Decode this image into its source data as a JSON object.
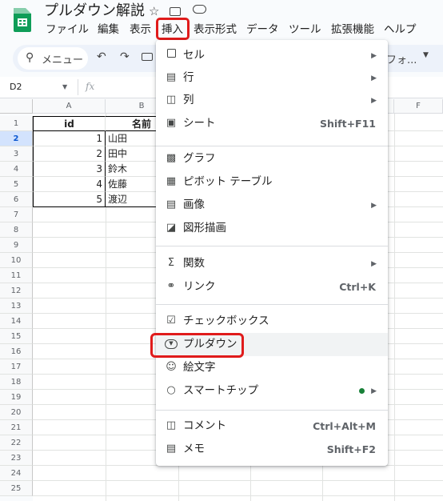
{
  "app": {
    "document_title": "プルダウン解説"
  },
  "menubar": [
    "ファイル",
    "編集",
    "表示",
    "挿入",
    "表示形式",
    "データ",
    "ツール",
    "拡張機能",
    "ヘルプ"
  ],
  "toolbar": {
    "search_label": "メニュー",
    "font_label": "フォ..."
  },
  "name_box": "D2",
  "fx_label": "fx",
  "columns": [
    "A",
    "B",
    "F"
  ],
  "rows": [
    "1",
    "2",
    "3",
    "4",
    "5",
    "6",
    "7",
    "8",
    "9",
    "10",
    "11",
    "12",
    "13",
    "14",
    "15",
    "16",
    "17",
    "18",
    "19",
    "20",
    "21",
    "22",
    "23",
    "24",
    "25"
  ],
  "table": {
    "headers": [
      "id",
      "名前"
    ],
    "records": [
      [
        "1",
        "山田"
      ],
      [
        "2",
        "田中"
      ],
      [
        "3",
        "鈴木"
      ],
      [
        "4",
        "佐藤"
      ],
      [
        "5",
        "渡辺"
      ]
    ]
  },
  "insert_menu": {
    "items": [
      {
        "label": "セル",
        "icon": "square-icon",
        "shortcut": "",
        "submenu": true
      },
      {
        "label": "行",
        "icon": "rows-icon",
        "shortcut": "",
        "submenu": true
      },
      {
        "label": "列",
        "icon": "columns-icon",
        "shortcut": "",
        "submenu": true
      },
      {
        "label": "シート",
        "icon": "sheet-icon",
        "shortcut": "Shift+F11",
        "submenu": false
      },
      {
        "label": "グラフ",
        "icon": "chart-icon",
        "shortcut": "",
        "submenu": false
      },
      {
        "label": "ピボット テーブル",
        "icon": "pivot-icon",
        "shortcut": "",
        "submenu": false
      },
      {
        "label": "画像",
        "icon": "image-icon",
        "shortcut": "",
        "submenu": true
      },
      {
        "label": "図形描画",
        "icon": "drawing-icon",
        "shortcut": "",
        "submenu": false
      },
      {
        "label": "関数",
        "icon": "sigma-icon",
        "shortcut": "",
        "submenu": true
      },
      {
        "label": "リンク",
        "icon": "link-icon",
        "shortcut": "Ctrl+K",
        "submenu": false
      },
      {
        "label": "チェックボックス",
        "icon": "checkbox-icon",
        "shortcut": "",
        "submenu": false
      },
      {
        "label": "プルダウン",
        "icon": "dropdown-icon",
        "shortcut": "",
        "submenu": false
      },
      {
        "label": "絵文字",
        "icon": "emoji-icon",
        "shortcut": "",
        "submenu": false
      },
      {
        "label": "スマートチップ",
        "icon": "smart-chip-icon",
        "shortcut": "",
        "submenu": true
      },
      {
        "label": "コメント",
        "icon": "comment-icon",
        "shortcut": "Ctrl+Alt+M",
        "submenu": false
      },
      {
        "label": "メモ",
        "icon": "note-icon",
        "shortcut": "Shift+F2",
        "submenu": false
      }
    ]
  },
  "colors": {
    "highlight_border": "#e01b1b",
    "sheets_green": "#0f9d58",
    "smart_chip_dot": "#188038",
    "hover_bg": "#f1f3f4"
  }
}
